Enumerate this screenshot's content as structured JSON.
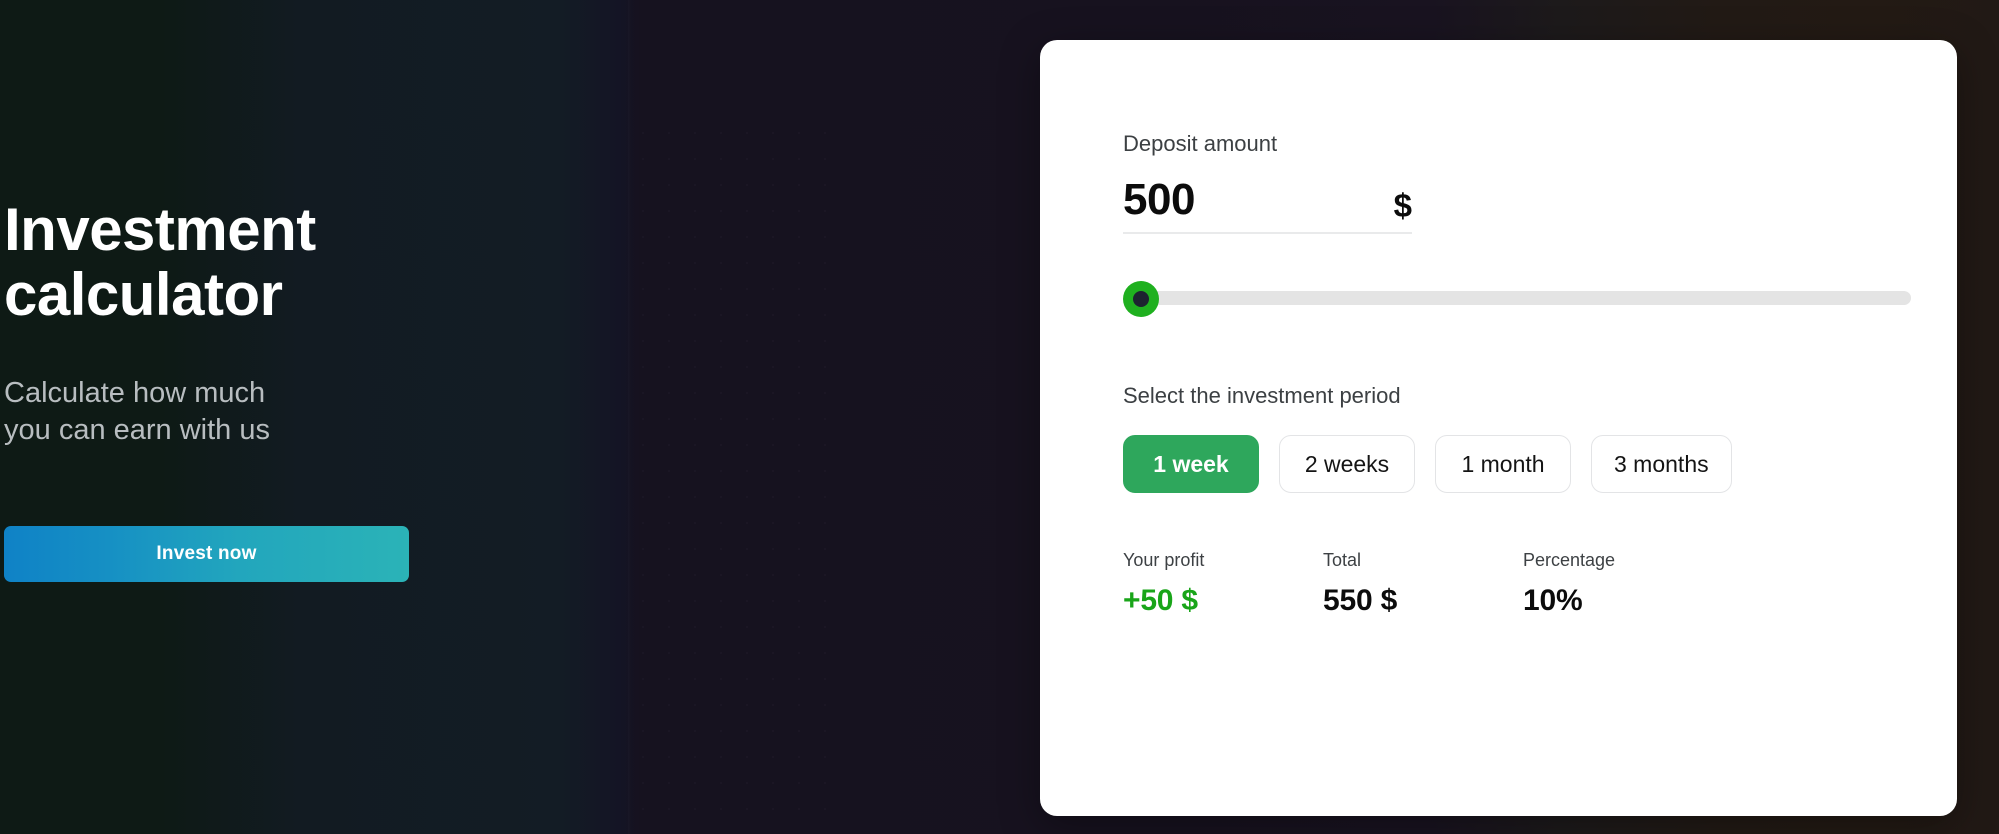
{
  "hero": {
    "title": "Investment\ncalculator",
    "subtitle": "Calculate how much\nyou can earn with us",
    "cta_label": "Invest now"
  },
  "calculator": {
    "deposit": {
      "label": "Deposit amount",
      "value": "500",
      "placeholder": "0",
      "currency": "$"
    },
    "slider": {
      "position_percent": 0,
      "thumb_color": "#1fb01f",
      "track_color": "#e4e4e4"
    },
    "period": {
      "label": "Select the investment period",
      "options": [
        {
          "label": "1 week",
          "selected": true
        },
        {
          "label": "2 weeks",
          "selected": false
        },
        {
          "label": "1 month",
          "selected": false
        },
        {
          "label": "3 months",
          "selected": false
        }
      ]
    },
    "results": [
      {
        "label": "Your profit",
        "value": "+50 $",
        "positive": true
      },
      {
        "label": "Total",
        "value": "550 $",
        "positive": false
      },
      {
        "label": "Percentage",
        "value": "10%",
        "positive": false
      }
    ]
  },
  "theme": {
    "accent_green": "#2ea75c",
    "profit_green": "#19a519",
    "cta_gradient_from": "#0f82c6",
    "cta_gradient_to": "#2bb3b7",
    "card_background": "#ffffff"
  }
}
